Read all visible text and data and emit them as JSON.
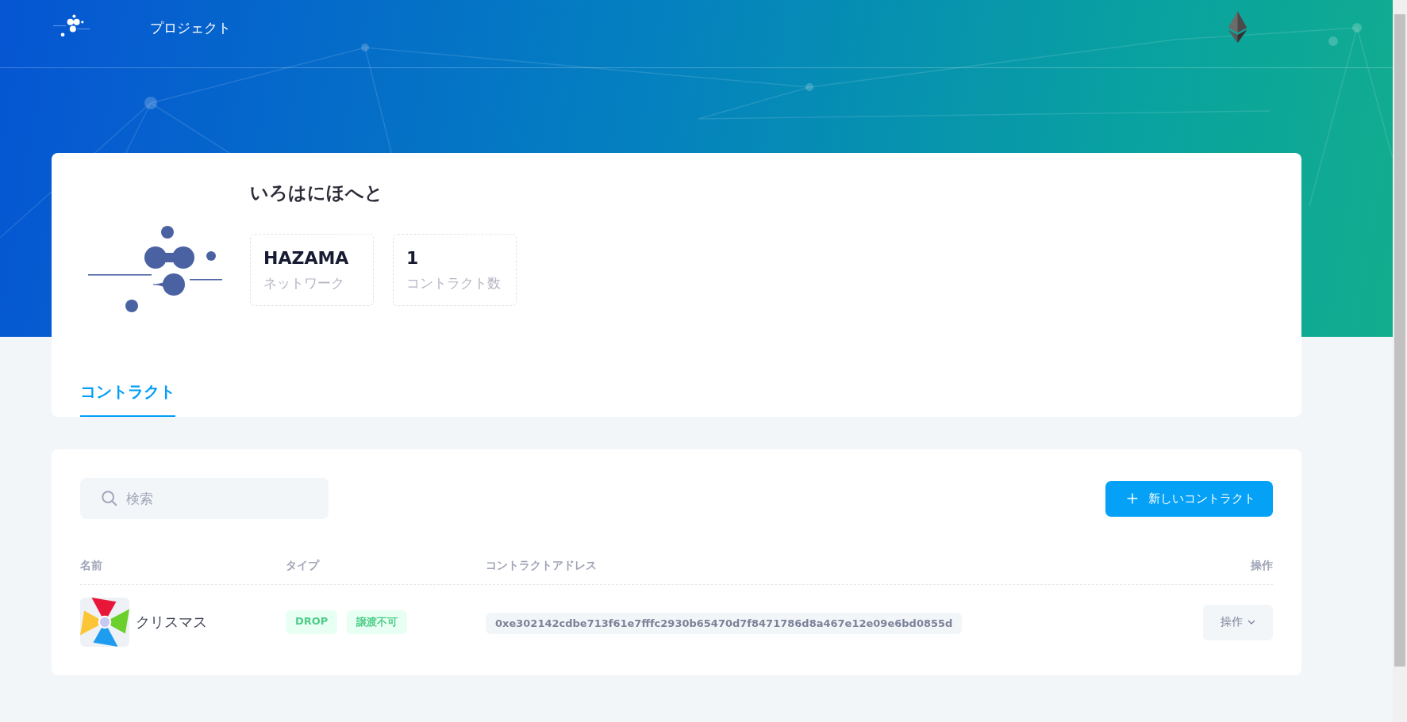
{
  "nav": {
    "title": "プロジェクト"
  },
  "project": {
    "name": "いろはにほへと",
    "stats": [
      {
        "value": "HAZAMA",
        "label": "ネットワーク"
      },
      {
        "value": "1",
        "label": "コントラクト数"
      }
    ]
  },
  "tabs": [
    {
      "label": "コントラクト",
      "selected": true
    }
  ],
  "search": {
    "placeholder": "検索"
  },
  "new_button": "新しいコントラクト",
  "table": {
    "columns": [
      "名前",
      "タイプ",
      "コントラクトアドレス",
      "操作"
    ],
    "rows": [
      {
        "name": "クリスマス",
        "tags": [
          "DROP",
          "譲渡不可"
        ],
        "address": "0xe302142cdbe713f61e7fffc2930b65470d7f8471786d8a467e12e09e6bd0855d",
        "action": "操作"
      }
    ]
  }
}
